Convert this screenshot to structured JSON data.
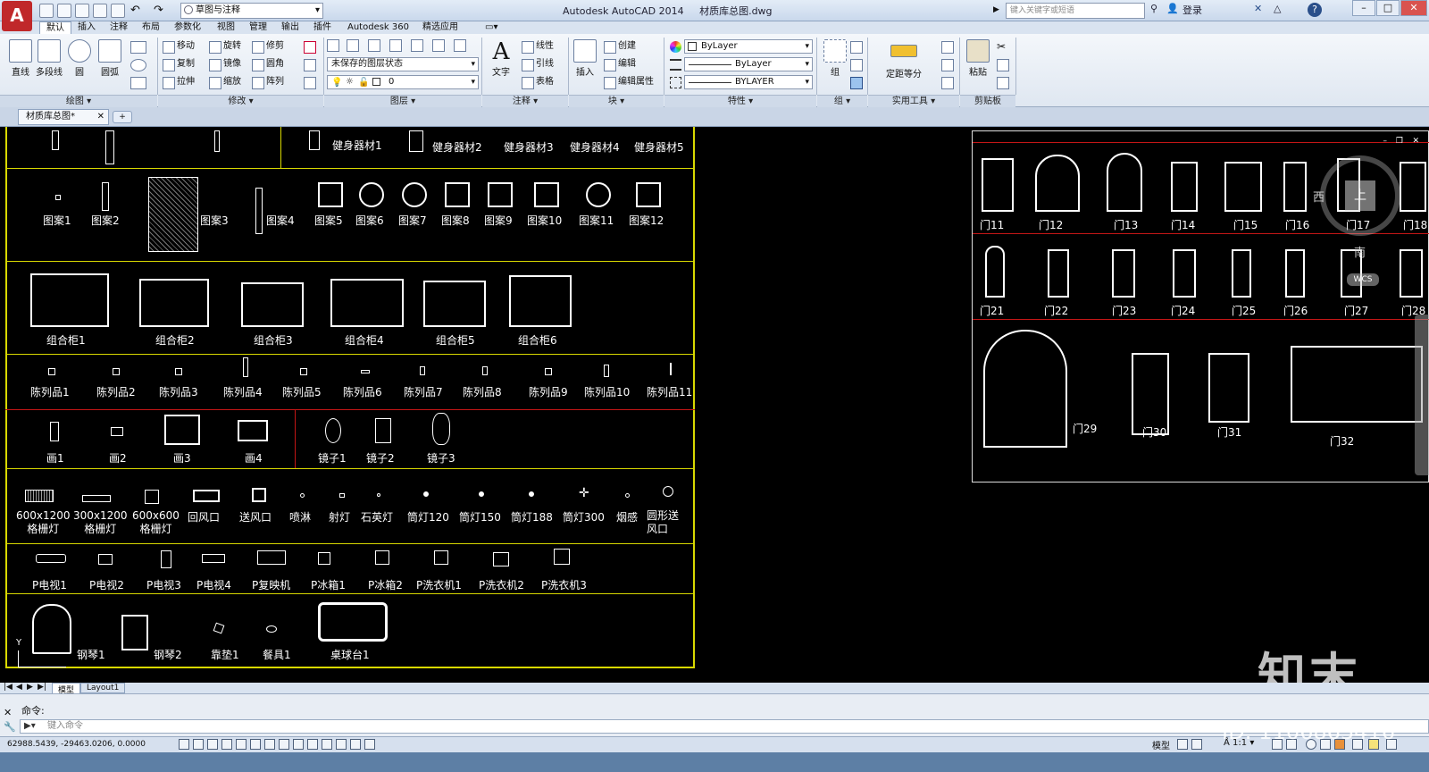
{
  "titlebar": {
    "app_title": "Autodesk AutoCAD 2014",
    "file_name": "材质库总图.dwg",
    "workspace": "草图与注释",
    "search_placeholder": "键入关键字或短语",
    "login": "登录",
    "logo_letter": "A"
  },
  "ribbon_tabs": [
    "默认",
    "插入",
    "注释",
    "布局",
    "参数化",
    "视图",
    "管理",
    "输出",
    "插件",
    "Autodesk 360",
    "精选应用"
  ],
  "ribbon": {
    "draw": {
      "title": "绘图 ▾",
      "line": "直线",
      "polyline": "多段线",
      "circle": "圆",
      "arc": "圆弧"
    },
    "modify": {
      "title": "修改 ▾",
      "move": "移动",
      "rotate": "旋转",
      "trim": "修剪",
      "copy": "复制",
      "mirror": "镜像",
      "fillet": "圆角",
      "stretch": "拉伸",
      "scale": "缩放",
      "array": "阵列"
    },
    "layers": {
      "title": "图层 ▾",
      "state": "未保存的图层状态",
      "current": "0"
    },
    "annotation": {
      "title": "注释 ▾",
      "text": "文字",
      "linear": "线性",
      "leader": "引线",
      "table": "表格"
    },
    "block": {
      "title": "块 ▾",
      "insert": "插入",
      "create": "创建",
      "edit": "编辑",
      "edit_attr": "编辑属性"
    },
    "properties": {
      "title": "特性 ▾",
      "color": "ByLayer",
      "linetype": "ByLayer",
      "lineweight": "BYLAYER"
    },
    "groups": {
      "title": "组 ▾",
      "group": "组"
    },
    "utilities": {
      "title": "实用工具 ▾",
      "measure": "定距等分"
    },
    "clipboard": {
      "title": "剪贴板",
      "paste": "粘贴"
    }
  },
  "doc_tab": "材质库总图*",
  "drawing": {
    "row1": [
      "健身器材1",
      "健身器材2",
      "健身器材3",
      "健身器材4",
      "健身器材5"
    ],
    "patterns": [
      "图案1",
      "图案2",
      "图案3",
      "图案4",
      "图案5",
      "图案6",
      "图案7",
      "图案8",
      "图案9",
      "图案10",
      "图案11",
      "图案12"
    ],
    "cabinets": [
      "组合柜1",
      "组合柜2",
      "组合柜3",
      "组合柜4",
      "组合柜5",
      "组合柜6"
    ],
    "displays": [
      "陈列品1",
      "陈列品2",
      "陈列品3",
      "陈列品4",
      "陈列品5",
      "陈列品6",
      "陈列品7",
      "陈列品8",
      "陈列品9",
      "陈列品10",
      "陈列品11"
    ],
    "paintings": [
      "画1",
      "画2",
      "画3",
      "画4"
    ],
    "mirrors": [
      "镜子1",
      "镜子2",
      "镜子3"
    ],
    "lights": [
      [
        "600x1200",
        "格栅灯"
      ],
      [
        "300x1200",
        "格栅灯"
      ],
      [
        "600x600",
        "格栅灯"
      ],
      [
        "回风口"
      ],
      [
        "送风口"
      ],
      [
        "喷淋"
      ],
      [
        "射灯"
      ],
      [
        "石英灯"
      ],
      [
        "筒灯120"
      ],
      [
        "筒灯150"
      ],
      [
        "筒灯188"
      ],
      [
        "筒灯300"
      ],
      [
        "烟感"
      ],
      [
        "圆形送",
        "风口"
      ]
    ],
    "appliances": [
      "P电视1",
      "P电视2",
      "P电视3",
      "P电视4",
      "P复映机",
      "P冰箱1",
      "P冰箱2",
      "P洗衣机1",
      "P洗衣机2",
      "P洗衣机3"
    ],
    "misc": [
      "钢琴1",
      "钢琴2",
      "靠垫1",
      "餐具1",
      "桌球台1"
    ],
    "doors_row1": [
      "门11",
      "门12",
      "门13",
      "门14",
      "门15",
      "门16",
      "门17",
      "门18"
    ],
    "doors_row2": [
      "门21",
      "门22",
      "门23",
      "门24",
      "门25",
      "门26",
      "门27",
      "门28"
    ],
    "doors_row3": [
      "门29",
      "门30",
      "门31",
      "门32"
    ],
    "viewcube": {
      "west": "西",
      "south": "南",
      "top": "上",
      "wcs": "WCS"
    },
    "watermark_logo": "知末",
    "watermark_id": "ID: 1106863416"
  },
  "layout_tabs": [
    "模型",
    "Layout1"
  ],
  "command": {
    "prompt": "命令:",
    "placeholder": "键入命令"
  },
  "status": {
    "coords": "62988.5439, -29463.0206, 0.0000",
    "model": "模型",
    "scale": "1:1"
  }
}
